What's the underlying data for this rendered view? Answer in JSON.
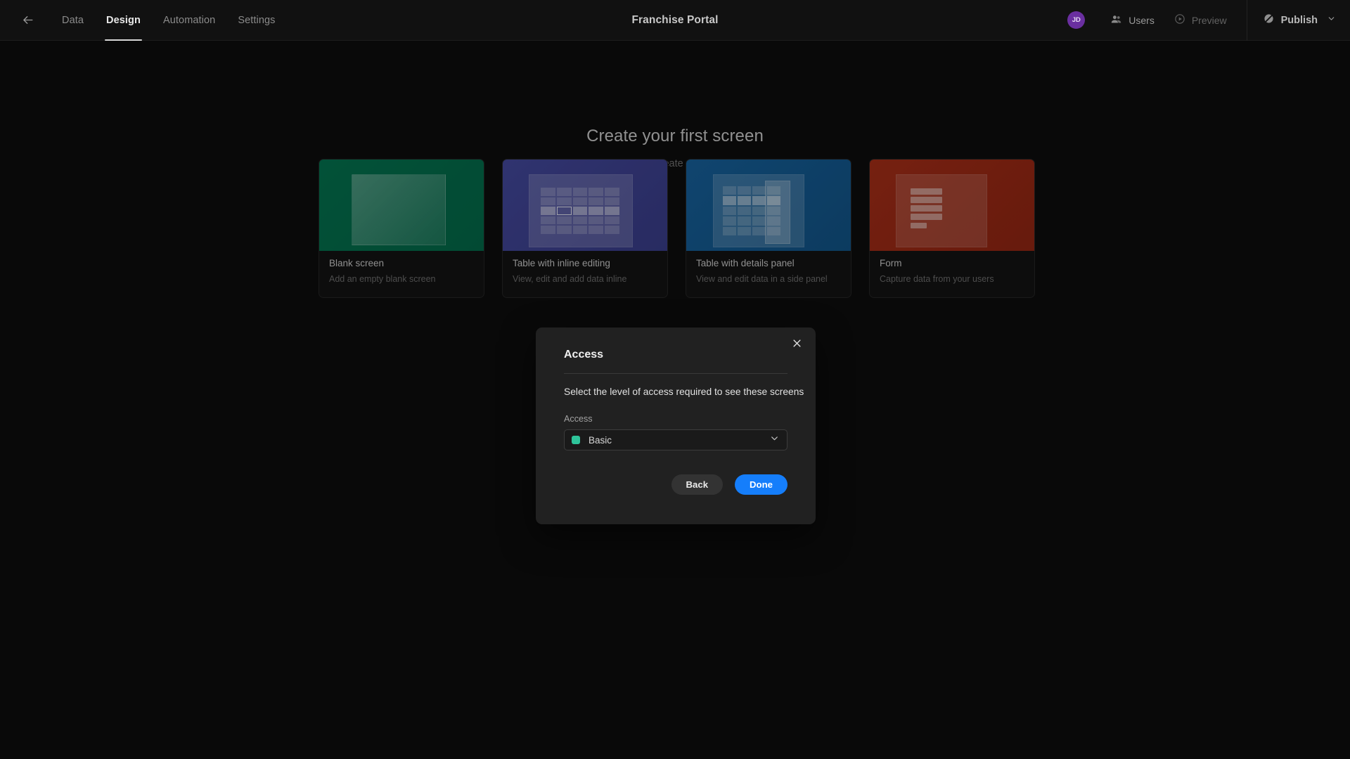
{
  "header": {
    "back_icon": "arrow-left-icon",
    "tabs": [
      {
        "label": "Data",
        "active": false
      },
      {
        "label": "Design",
        "active": true
      },
      {
        "label": "Automation",
        "active": false
      },
      {
        "label": "Settings",
        "active": false
      }
    ],
    "app_title": "Franchise Portal",
    "avatar_initials": "JD",
    "avatar_color": "#6a2fa0",
    "users_label": "Users",
    "users_icon": "users-icon",
    "preview_label": "Preview",
    "preview_icon": "play-circle-icon",
    "publish_label": "Publish",
    "publish_icon": "unpublished-slash-icon",
    "publish_chevron_icon": "chevron-down-icon"
  },
  "main": {
    "title": "Create your first screen",
    "subtitle": "Start from scratch or create screens from your data",
    "cards": [
      {
        "title": "Blank screen",
        "desc": "Add an empty blank screen",
        "accent": "#03714f",
        "art": "blank"
      },
      {
        "title": "Table with inline editing",
        "desc": "View, edit and add data inline",
        "accent": "#3f4394",
        "art": "table-inline"
      },
      {
        "title": "Table with details panel",
        "desc": "View and edit data in a side panel",
        "accent": "#145b93",
        "art": "table-details"
      },
      {
        "title": "Form",
        "desc": "Capture data from your users",
        "accent": "#9e2a15",
        "art": "form"
      }
    ]
  },
  "modal": {
    "title": "Access",
    "close_icon": "close-icon",
    "description": "Select the level of access required to see these screens",
    "field_label": "Access",
    "select_value": "Basic",
    "select_swatch_color": "#2ec49a",
    "select_chevron_icon": "chevron-down-icon",
    "back_label": "Back",
    "done_label": "Done",
    "primary_color": "#157efb"
  }
}
